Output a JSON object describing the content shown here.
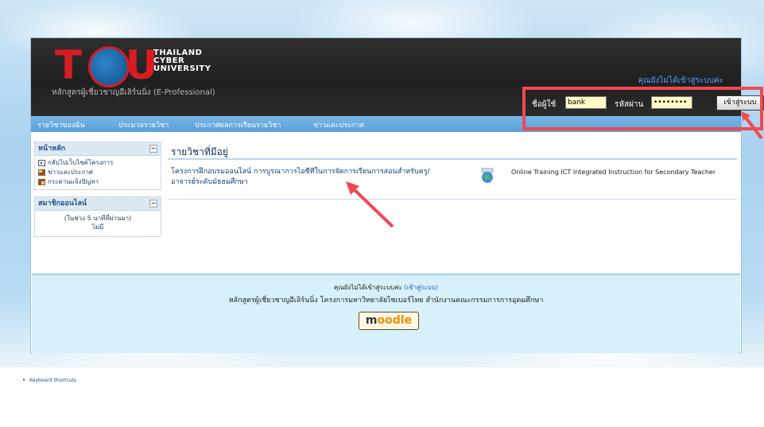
{
  "header": {
    "logo_letters": [
      "T",
      "C",
      "U"
    ],
    "logo_text_lines": [
      "THAILAND",
      "CYBER",
      "UNIVERSITY"
    ],
    "subtitle": "หลักสูตรผู้เชี่ยวชาญอีเลิร์นนิ่ง (E-Professional)",
    "login_status": "คุณยังไม่ได้เข้าสู่ระบบค่ะ"
  },
  "login": {
    "username_label": "ชื่อผู้ใช้",
    "username_value": "bank",
    "password_label": "รหัสผ่าน",
    "password_value": "••••••••",
    "button_label": "เข้าสู่ระบบ"
  },
  "nav": {
    "items": [
      {
        "label": "รายวิชาของฉัน"
      },
      {
        "label": "ประมวลรายวิชา"
      },
      {
        "label": "ประกาศผลการเรียนรายวิชา"
      },
      {
        "label": "ข่าวและประกาศ"
      }
    ]
  },
  "sidebar": {
    "main_block": {
      "title": "หน้าหลัก",
      "links": [
        {
          "label": "กลับไปเว็บไซต์โครงการ",
          "icon": "page-back-icon"
        },
        {
          "label": "ข่าวและประกาศ",
          "icon": "news-icon"
        },
        {
          "label": "กระดานแจ้งปัญหา",
          "icon": "forum-icon"
        }
      ]
    },
    "online_block": {
      "title": "สมาชิกออนไลน์",
      "period": "(ในช่วง 5 นาทีที่ผ่านมา)",
      "none": "ไม่มี"
    }
  },
  "main": {
    "title": "รายวิชาที่มีอยู่",
    "course": {
      "title_th": "โครงการฝึกอบรมออนไลน์ การบูรณาการไอซีทีในการจัดการเรียนการสอนสำหรับครู/อาจารย์ระดับมัธยมศึกษา",
      "title_en": "Online Training ICT Integrated Instruction for Secondary Teacher",
      "icon": "globe-icon"
    }
  },
  "footer": {
    "login_notice": "คุณยังไม่ได้เข้าสู่ระบบค่ะ",
    "login_link": "(เข้าสู่ระบบ)",
    "org": "หลักสูตรผู้เชี่ยวชาญอีเลิร์นนิ่ง โครงการมหาวิทยาลัยไซเบอร์ไทย สำนักงานคณะกรรมการการอุดมศึกษา",
    "moodle_label": "moodle"
  },
  "misc": {
    "keyboard_shortcuts": "Keyboard Shortcuts"
  },
  "colors": {
    "annotation_red": "#ef4a50",
    "header_dark": "#262626",
    "nav_blue": "#5b9fd9",
    "logo_red": "#d71d23",
    "footer_bg": "#d7f0f9"
  }
}
